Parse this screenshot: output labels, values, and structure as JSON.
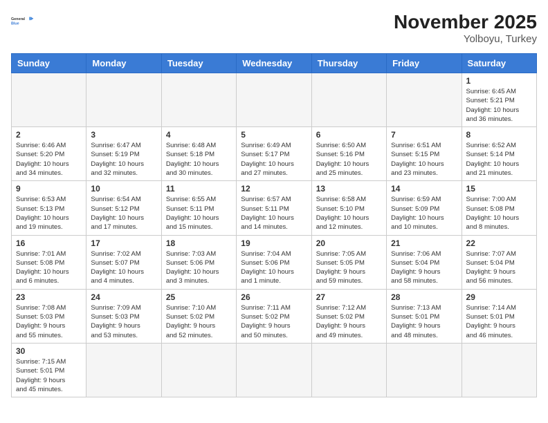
{
  "header": {
    "title": "November 2025",
    "subtitle": "Yolboyu, Turkey",
    "logo_general": "General",
    "logo_blue": "Blue"
  },
  "weekdays": [
    "Sunday",
    "Monday",
    "Tuesday",
    "Wednesday",
    "Thursday",
    "Friday",
    "Saturday"
  ],
  "days": [
    {
      "date": "",
      "info": ""
    },
    {
      "date": "",
      "info": ""
    },
    {
      "date": "",
      "info": ""
    },
    {
      "date": "",
      "info": ""
    },
    {
      "date": "",
      "info": ""
    },
    {
      "date": "",
      "info": ""
    },
    {
      "date": "1",
      "info": "Sunrise: 6:45 AM\nSunset: 5:21 PM\nDaylight: 10 hours\nand 36 minutes."
    },
    {
      "date": "2",
      "info": "Sunrise: 6:46 AM\nSunset: 5:20 PM\nDaylight: 10 hours\nand 34 minutes."
    },
    {
      "date": "3",
      "info": "Sunrise: 6:47 AM\nSunset: 5:19 PM\nDaylight: 10 hours\nand 32 minutes."
    },
    {
      "date": "4",
      "info": "Sunrise: 6:48 AM\nSunset: 5:18 PM\nDaylight: 10 hours\nand 30 minutes."
    },
    {
      "date": "5",
      "info": "Sunrise: 6:49 AM\nSunset: 5:17 PM\nDaylight: 10 hours\nand 27 minutes."
    },
    {
      "date": "6",
      "info": "Sunrise: 6:50 AM\nSunset: 5:16 PM\nDaylight: 10 hours\nand 25 minutes."
    },
    {
      "date": "7",
      "info": "Sunrise: 6:51 AM\nSunset: 5:15 PM\nDaylight: 10 hours\nand 23 minutes."
    },
    {
      "date": "8",
      "info": "Sunrise: 6:52 AM\nSunset: 5:14 PM\nDaylight: 10 hours\nand 21 minutes."
    },
    {
      "date": "9",
      "info": "Sunrise: 6:53 AM\nSunset: 5:13 PM\nDaylight: 10 hours\nand 19 minutes."
    },
    {
      "date": "10",
      "info": "Sunrise: 6:54 AM\nSunset: 5:12 PM\nDaylight: 10 hours\nand 17 minutes."
    },
    {
      "date": "11",
      "info": "Sunrise: 6:55 AM\nSunset: 5:11 PM\nDaylight: 10 hours\nand 15 minutes."
    },
    {
      "date": "12",
      "info": "Sunrise: 6:57 AM\nSunset: 5:11 PM\nDaylight: 10 hours\nand 14 minutes."
    },
    {
      "date": "13",
      "info": "Sunrise: 6:58 AM\nSunset: 5:10 PM\nDaylight: 10 hours\nand 12 minutes."
    },
    {
      "date": "14",
      "info": "Sunrise: 6:59 AM\nSunset: 5:09 PM\nDaylight: 10 hours\nand 10 minutes."
    },
    {
      "date": "15",
      "info": "Sunrise: 7:00 AM\nSunset: 5:08 PM\nDaylight: 10 hours\nand 8 minutes."
    },
    {
      "date": "16",
      "info": "Sunrise: 7:01 AM\nSunset: 5:08 PM\nDaylight: 10 hours\nand 6 minutes."
    },
    {
      "date": "17",
      "info": "Sunrise: 7:02 AM\nSunset: 5:07 PM\nDaylight: 10 hours\nand 4 minutes."
    },
    {
      "date": "18",
      "info": "Sunrise: 7:03 AM\nSunset: 5:06 PM\nDaylight: 10 hours\nand 3 minutes."
    },
    {
      "date": "19",
      "info": "Sunrise: 7:04 AM\nSunset: 5:06 PM\nDaylight: 10 hours\nand 1 minute."
    },
    {
      "date": "20",
      "info": "Sunrise: 7:05 AM\nSunset: 5:05 PM\nDaylight: 9 hours\nand 59 minutes."
    },
    {
      "date": "21",
      "info": "Sunrise: 7:06 AM\nSunset: 5:04 PM\nDaylight: 9 hours\nand 58 minutes."
    },
    {
      "date": "22",
      "info": "Sunrise: 7:07 AM\nSunset: 5:04 PM\nDaylight: 9 hours\nand 56 minutes."
    },
    {
      "date": "23",
      "info": "Sunrise: 7:08 AM\nSunset: 5:03 PM\nDaylight: 9 hours\nand 55 minutes."
    },
    {
      "date": "24",
      "info": "Sunrise: 7:09 AM\nSunset: 5:03 PM\nDaylight: 9 hours\nand 53 minutes."
    },
    {
      "date": "25",
      "info": "Sunrise: 7:10 AM\nSunset: 5:02 PM\nDaylight: 9 hours\nand 52 minutes."
    },
    {
      "date": "26",
      "info": "Sunrise: 7:11 AM\nSunset: 5:02 PM\nDaylight: 9 hours\nand 50 minutes."
    },
    {
      "date": "27",
      "info": "Sunrise: 7:12 AM\nSunset: 5:02 PM\nDaylight: 9 hours\nand 49 minutes."
    },
    {
      "date": "28",
      "info": "Sunrise: 7:13 AM\nSunset: 5:01 PM\nDaylight: 9 hours\nand 48 minutes."
    },
    {
      "date": "29",
      "info": "Sunrise: 7:14 AM\nSunset: 5:01 PM\nDaylight: 9 hours\nand 46 minutes."
    },
    {
      "date": "30",
      "info": "Sunrise: 7:15 AM\nSunset: 5:01 PM\nDaylight: 9 hours\nand 45 minutes."
    },
    {
      "date": "",
      "info": ""
    },
    {
      "date": "",
      "info": ""
    },
    {
      "date": "",
      "info": ""
    },
    {
      "date": "",
      "info": ""
    },
    {
      "date": "",
      "info": ""
    },
    {
      "date": "",
      "info": ""
    }
  ]
}
